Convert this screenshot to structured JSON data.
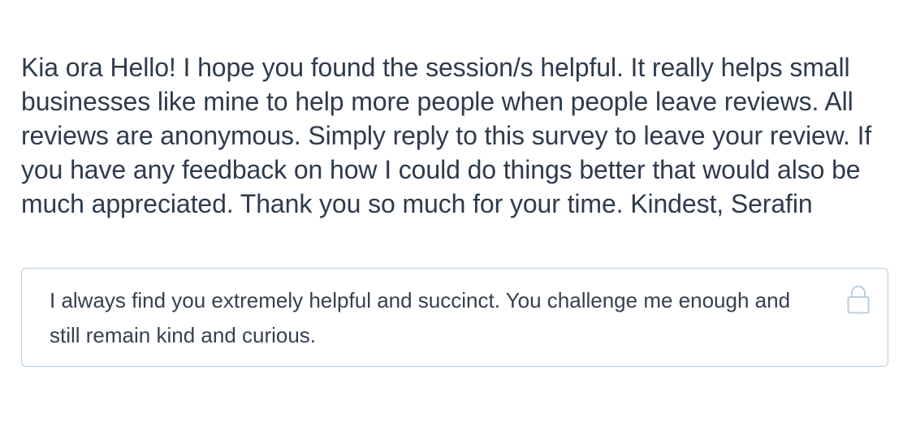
{
  "question": {
    "text": "Kia ora Hello! I hope you found the session/s helpful. It really helps small businesses like mine to help more people when people leave reviews. All reviews are anonymous. Simply reply to this survey to leave your review. If you have any feedback on how I could do things better that would also be much appreciated. Thank you so much for your time. Kindest, Serafin"
  },
  "answer": {
    "text": "I always find you extremely helpful and succinct. You challenge me enough and still remain kind and curious.",
    "icon": "lock-icon"
  },
  "colors": {
    "text": "#2f3b4c",
    "answer_border": "#b9cfe0",
    "lock": "#b9cfe0"
  }
}
